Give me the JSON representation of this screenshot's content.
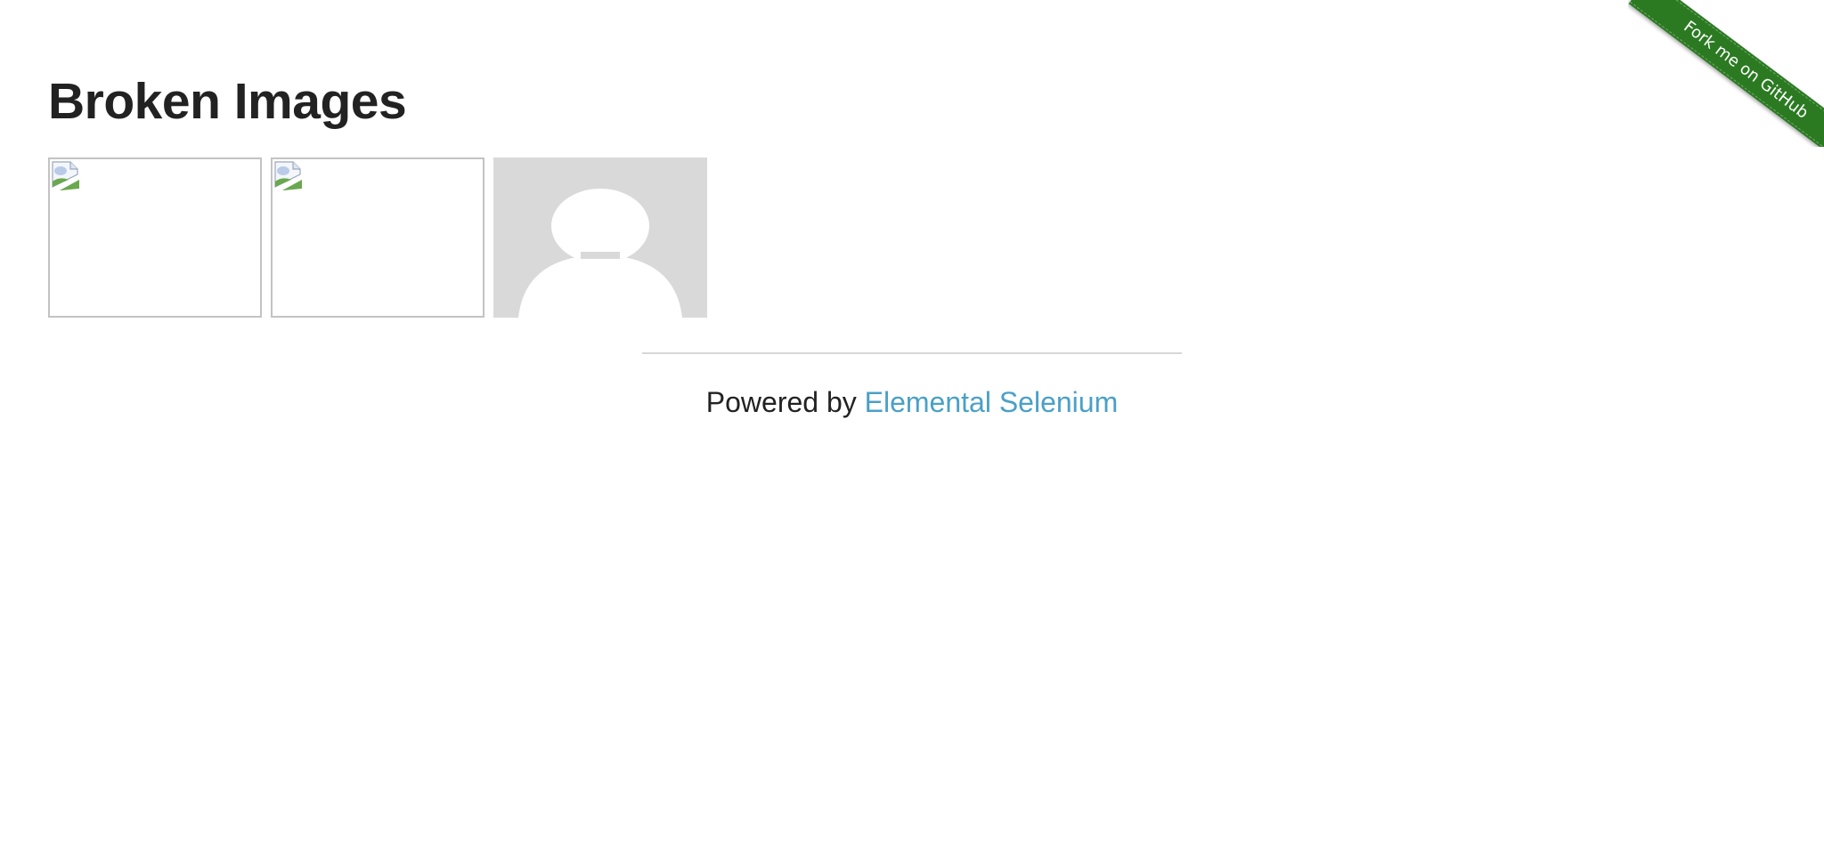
{
  "ribbon": {
    "label": "Fork me on GitHub",
    "color": "#2b7a22"
  },
  "heading": {
    "title": "Broken Images"
  },
  "images": [
    {
      "kind": "broken",
      "icon": "broken-image-icon"
    },
    {
      "kind": "broken",
      "icon": "broken-image-icon"
    },
    {
      "kind": "avatar",
      "icon": "avatar-placeholder-icon"
    }
  ],
  "footer": {
    "prefix": "Powered by",
    "link_label": "Elemental Selenium",
    "link_color": "#4aa0c6"
  }
}
